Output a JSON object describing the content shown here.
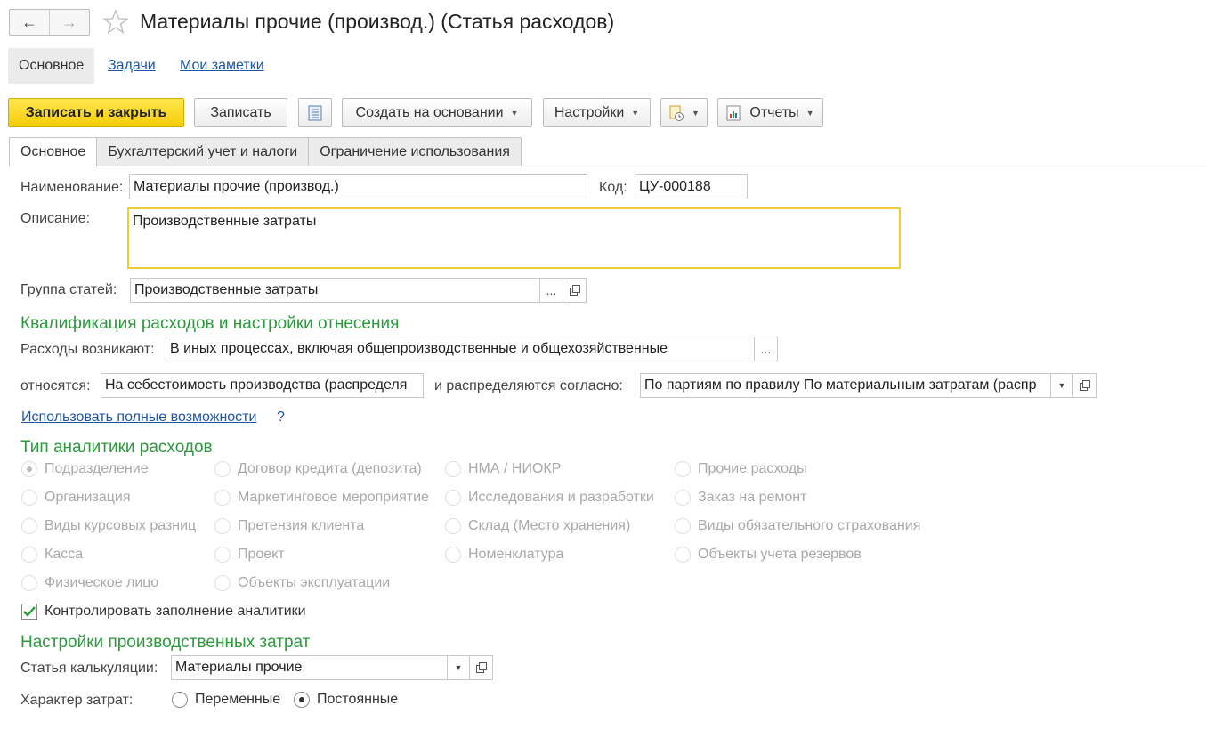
{
  "window": {
    "title": "Материалы прочие (производ.) (Статья расходов)"
  },
  "nav": {
    "back_icon": "arrow-left-icon",
    "forward_icon": "arrow-right-icon",
    "favorite_icon": "star-icon",
    "tabs": [
      "Основное",
      "Задачи",
      "Мои заметки"
    ]
  },
  "toolbar": {
    "save_close": "Записать и закрыть",
    "save": "Записать",
    "create_based": "Создать на основании",
    "settings": "Настройки",
    "reports": "Отчеты"
  },
  "tabs": [
    "Основное",
    "Бухгалтерский учет и налоги",
    "Ограничение использования"
  ],
  "form": {
    "name_label": "Наименование:",
    "name_value": "Материалы прочие (производ.)",
    "code_label": "Код:",
    "code_value": "ЦУ-000188",
    "desc_label": "Описание:",
    "desc_value": "Производственные затраты",
    "group_label": "Группа статей:",
    "group_value": "Производственные затраты",
    "section1": "Квалификация расходов и настройки отнесения",
    "arise_label": "Расходы возникают:",
    "arise_value": "В иных процессах, включая общепроизводственные и общехозяйственные",
    "relate_label": "относятся:",
    "relate_value": "На себестоимость производства (распределя",
    "distribute_label": "и распределяются согласно:",
    "distribute_value": "По партиям по правилу По материальным затратам (распр",
    "full_link": "Использовать полные возможности",
    "help": "?",
    "section2": "Тип аналитики расходов",
    "analytics": {
      "col1": [
        "Подразделение",
        "Организация",
        "Виды курсовых разниц",
        "Касса",
        "Физическое лицо"
      ],
      "col2": [
        "Договор кредита (депозита)",
        "Маркетинговое мероприятие",
        "Претензия клиента",
        "Проект",
        "Объекты эксплуатации"
      ],
      "col3": [
        "НМА / НИОКР",
        "Исследования и разработки",
        "Склад (Место хранения)",
        "Номенклатура"
      ],
      "col4": [
        "Прочие расходы",
        "Заказ на ремонт",
        "Виды обязательного страхования",
        "Объекты учета резервов"
      ]
    },
    "control_check": "Контролировать заполнение аналитики",
    "section3": "Настройки производственных затрат",
    "calc_label": "Статья калькуляции:",
    "calc_value": "Материалы прочие",
    "cost_label": "Характер затрат:",
    "cost_options": [
      "Переменные",
      "Постоянные"
    ]
  },
  "colors": {
    "accent_yellow": "#f5cd06",
    "section_green": "#2a9a3c",
    "link_blue": "#1d55a8"
  }
}
